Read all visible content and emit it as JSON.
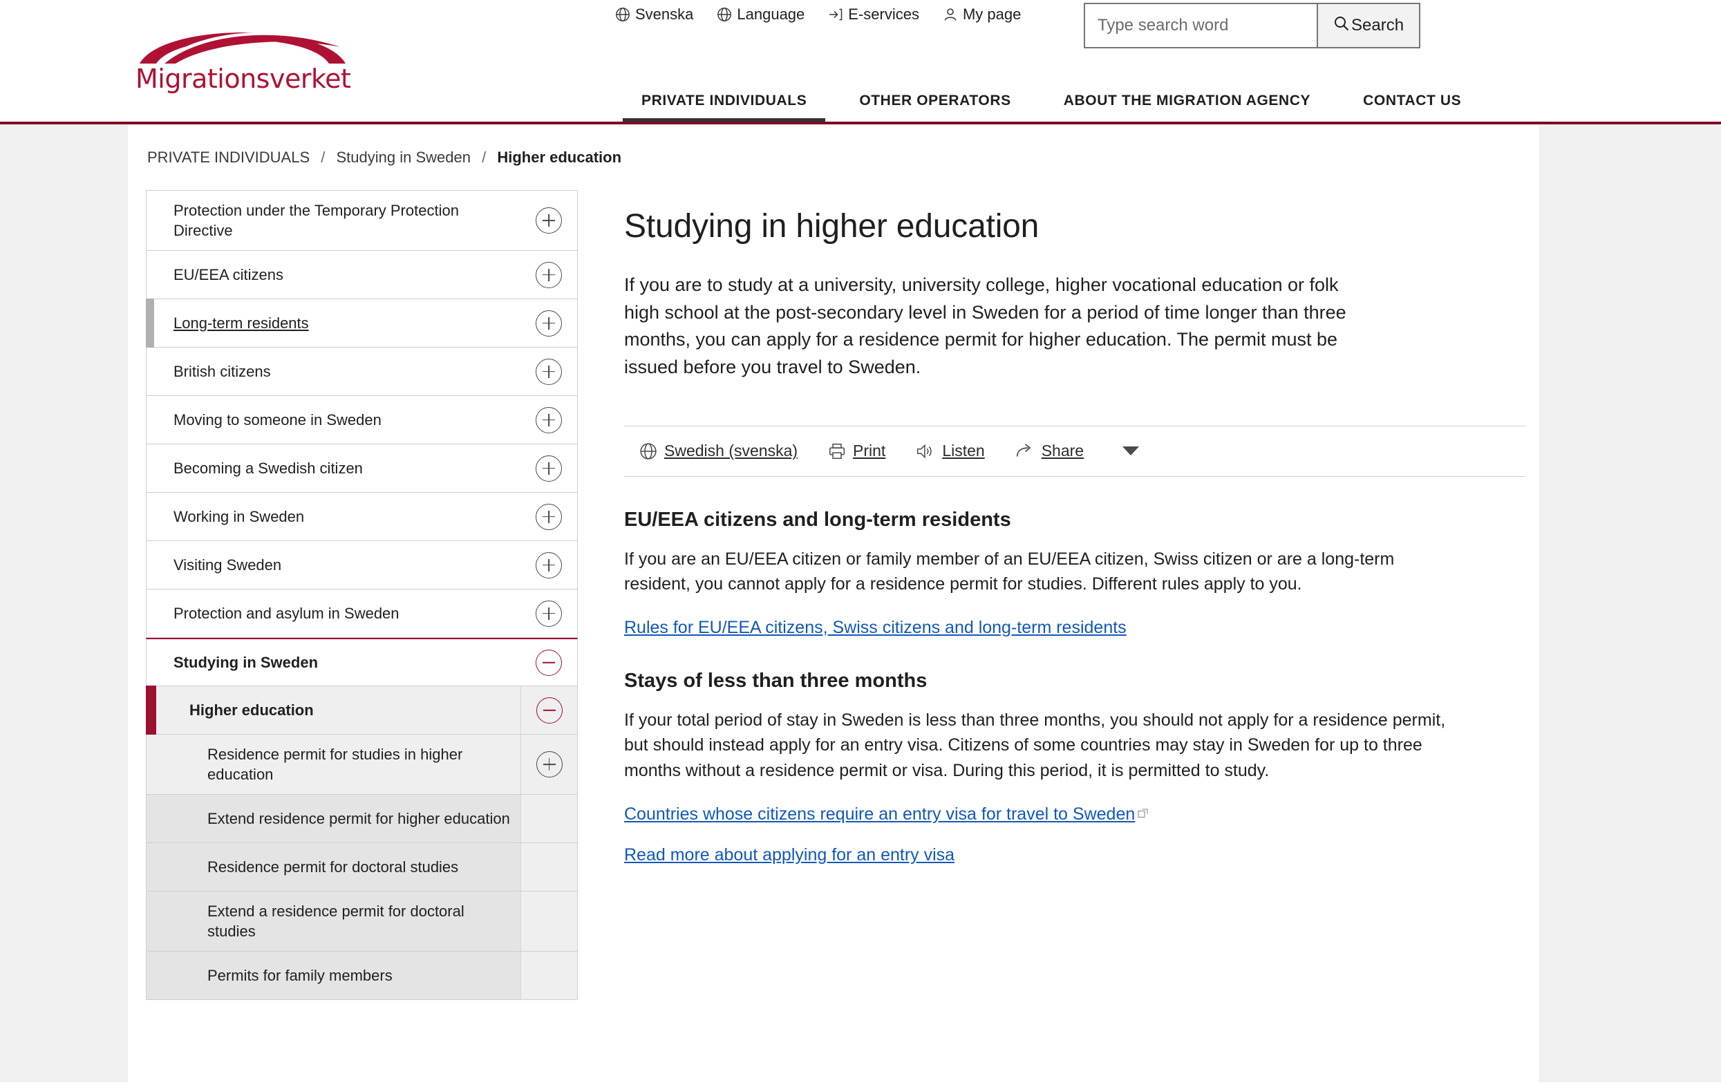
{
  "brand": {
    "name": "Migrationsverket",
    "color": "#AF1134",
    "rule_color": "#7b0d21"
  },
  "header": {
    "utility_links": [
      {
        "label": "Svenska",
        "icon": "globe-icon"
      },
      {
        "label": "Language",
        "icon": "globe-icon"
      },
      {
        "label": "E-services",
        "icon": "login-arrow-icon"
      },
      {
        "label": "My page",
        "icon": "user-icon"
      }
    ],
    "search": {
      "placeholder": "Type search word",
      "value": "",
      "button_label": "Search"
    },
    "nav": [
      {
        "label": "PRIVATE INDIVIDUALS",
        "active": true
      },
      {
        "label": "OTHER OPERATORS",
        "active": false
      },
      {
        "label": "ABOUT THE MIGRATION AGENCY",
        "active": false
      },
      {
        "label": "CONTACT US",
        "active": false
      }
    ]
  },
  "breadcrumb": {
    "items": [
      "PRIVATE INDIVIDUALS",
      "Studying in Sweden"
    ],
    "current": "Higher education",
    "separator": "/"
  },
  "sidebar": {
    "items": [
      {
        "label": "Protection under the Temporary Protection Directive",
        "toggle": "plus",
        "state": "default"
      },
      {
        "label": "EU/EEA citizens",
        "toggle": "plus",
        "state": "default"
      },
      {
        "label": "Long-term residents",
        "toggle": "plus",
        "state": "hover"
      },
      {
        "label": "British citizens",
        "toggle": "plus",
        "state": "default"
      },
      {
        "label": "Moving to someone in Sweden",
        "toggle": "plus",
        "state": "default"
      },
      {
        "label": "Becoming a Swedish citizen",
        "toggle": "plus",
        "state": "default"
      },
      {
        "label": "Working in Sweden",
        "toggle": "plus",
        "state": "default"
      },
      {
        "label": "Visiting Sweden",
        "toggle": "plus",
        "state": "default"
      },
      {
        "label": "Protection and asylum in Sweden",
        "toggle": "plus",
        "state": "default"
      },
      {
        "label": "Studying in Sweden",
        "toggle": "minus",
        "state": "open-parent"
      },
      {
        "label": "Higher education",
        "toggle": "minus",
        "state": "current"
      },
      {
        "label": "Residence permit for studies in higher education",
        "toggle": "plus",
        "state": "child"
      },
      {
        "label": "Extend residence permit for higher education",
        "toggle": "none",
        "state": "child"
      },
      {
        "label": "Residence permit for doctoral studies",
        "toggle": "none",
        "state": "child"
      },
      {
        "label": "Extend a residence permit for doctoral studies",
        "toggle": "none",
        "state": "child"
      },
      {
        "label": "Permits for family members",
        "toggle": "none",
        "state": "child"
      }
    ]
  },
  "main": {
    "title": "Studying in higher education",
    "lede": "If you are to study at a university, university college, higher vocational education or folk high school at the post-secondary level in Sweden for a period of time longer than three months, you can apply for a residence permit for higher education. The permit must be issued before you travel to Sweden.",
    "toolbar": [
      {
        "label": "Swedish (svenska)",
        "icon": "globe-icon"
      },
      {
        "label": "Print",
        "icon": "printer-icon"
      },
      {
        "label": "Listen",
        "icon": "speaker-icon"
      },
      {
        "label": "Share",
        "icon": "share-icon"
      }
    ],
    "sections": [
      {
        "heading": "EU/EEA citizens and long-term residents",
        "body": "If you are an EU/EEA citizen or family member of an EU/EEA citizen, Swiss citizen or are a long-term resident, you cannot apply for a residence permit for studies. Different rules apply to you.",
        "links": [
          {
            "label": "Rules for EU/EEA citizens, Swiss citizens and long-term residents",
            "external": false
          }
        ]
      },
      {
        "heading": "Stays of less than three months",
        "body": "If your total period of stay in Sweden is less than three months, you should not apply for a residence permit, but should instead apply for an entry visa. Citizens of some countries may stay in Sweden for up to three months without a residence permit or visa. During this period, it is permitted to study.",
        "links": [
          {
            "label": "Countries whose citizens require an entry visa for travel to Sweden",
            "external": true
          },
          {
            "label": "Read more about applying for an entry visa",
            "external": false
          }
        ]
      }
    ]
  }
}
